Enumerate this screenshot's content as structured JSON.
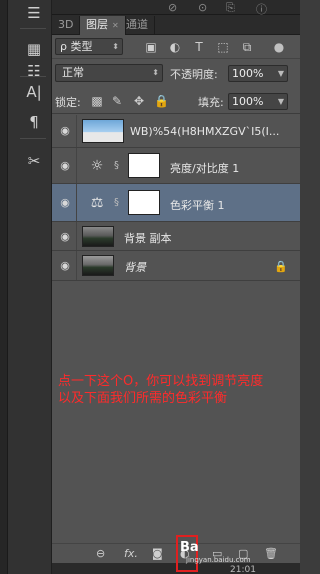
{
  "tabs": [
    {
      "label": "3D"
    },
    {
      "label": "图层",
      "active": true
    },
    {
      "label": "通道"
    }
  ],
  "filter": {
    "kind_label": "ρ 类型",
    "icons": [
      "image-filter-icon",
      "adjustment-filter-icon",
      "type-filter-icon",
      "shape-filter-icon",
      "smart-object-filter-icon"
    ]
  },
  "blend": {
    "mode": "正常",
    "opacity_label": "不透明度:",
    "opacity_value": "100%",
    "lock_label": "锁定:",
    "fill_label": "填充:",
    "fill_value": "100%"
  },
  "layers": [
    {
      "name": "WB)%54(H8HMXZGV`I5(I...",
      "kind": "image-transparent"
    },
    {
      "name": "亮度/对比度 1",
      "kind": "adjustment-brightness"
    },
    {
      "name": "色彩平衡 1",
      "kind": "adjustment-color-balance",
      "selected": true
    },
    {
      "name": "背景 副本",
      "kind": "photo"
    },
    {
      "name": "背景",
      "kind": "photo-background",
      "locked": true
    }
  ],
  "annotation": {
    "line1": "点一下这个O，你可以找到调节亮度",
    "line2": "以及下面我们所需的色彩平衡"
  },
  "bottom": {
    "fx_label": "fx.",
    "watermark": "Ba",
    "watermark_site": "jingyan.baidu.com",
    "clock": "21:01"
  },
  "colors": {
    "panel": "#535353",
    "selected_layer": "#5e7087",
    "annotation": "#ff2b2b"
  }
}
